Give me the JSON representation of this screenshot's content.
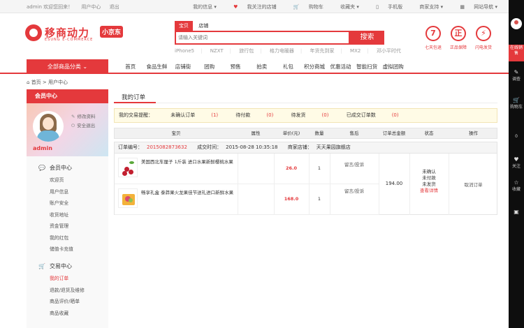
{
  "topbar": {
    "welcome": "admin 欢迎您回来！",
    "user_center": "用户中心",
    "logout": "退出",
    "my_info": "我的信息",
    "my_stores": "我关注的店铺",
    "cart": "购物车",
    "favorites": "收藏夹",
    "mobile": "手机版",
    "merchant": "商家支持",
    "sitenav": "网站导航"
  },
  "logo": {
    "name": "移商动力",
    "sub": "ESUNG E-COMMERCE",
    "tag": "小京东"
  },
  "search": {
    "tabs": [
      "宝贝",
      "店铺"
    ],
    "placeholder": "请输入关键词",
    "button": "搜索",
    "hot": [
      "iPhone5",
      "NZXT",
      "旅行包",
      "格力电暖器",
      "年货先到家",
      "MX2",
      "邓小平时代"
    ]
  },
  "badges": [
    {
      "icon": "7",
      "label": "七天包退"
    },
    {
      "icon": "正",
      "label": "正品保障"
    },
    {
      "icon": "⚡",
      "label": "闪电发货"
    }
  ],
  "nav": {
    "category_label": "全部商品分类",
    "items": [
      "首页",
      "食品生鲜",
      "店铺街",
      "团购",
      "预售",
      "拍卖",
      "礼包",
      "积分商城",
      "优惠活动",
      "智能扫货",
      "虚拟团购"
    ]
  },
  "breadcrumb": {
    "home": "首页",
    "sep": " > ",
    "current": "用户中心"
  },
  "sidebar": {
    "title": "会员中心",
    "username": "admin",
    "edit_profile": "修改资料",
    "safe_logout": "安全退出",
    "sections": [
      {
        "title": "会员中心",
        "items": [
          "欢迎页",
          "用户信息",
          "账户安全",
          "收货地址",
          "资金管理",
          "我的红包",
          "储值卡充值"
        ]
      },
      {
        "title": "交易中心",
        "items": [
          "我的订单",
          "退款/退货及维修",
          "商品评价/晒单",
          "商品收藏"
        ]
      }
    ],
    "active_item": "我的订单"
  },
  "main": {
    "title": "我的订单",
    "reminder": {
      "label": "我的交易提醒：",
      "unconfirmed": "未确认订单",
      "unconfirmed_count": "(1)",
      "unpaid": "待付款",
      "unpaid_count": "(0)",
      "unshipped": "待发货",
      "unshipped_count": "(0)",
      "done": "已成交订单数",
      "done_count": "(0)"
    },
    "table": {
      "headers": [
        "宝贝",
        "属性",
        "单价(元)",
        "数量",
        "售后",
        "订单总金额",
        "状态",
        "操作"
      ],
      "order_no_label": "订单编号：",
      "order_no": "2015082873632",
      "time_label": "成交时间：",
      "time": "2015-08-28 10:35:18",
      "store_label": "商家店铺：",
      "store": "天天果园旗舰店",
      "products": [
        {
          "name": "美国西北车厘子 1斤装 进口水果新鲜樱桃水果",
          "price": "26.0",
          "qty": "1",
          "aftersale": "留言/投诉"
        },
        {
          "name": "畅享礼盒 泰莽果火龙果佳节送礼进口新鲜水果",
          "price": "168.0",
          "qty": "1",
          "aftersale": "留言/投诉"
        }
      ],
      "total": "194.00",
      "status": [
        "未确认",
        "未付款",
        "未发货"
      ],
      "status_link": "查看详情",
      "operation": "取消订单"
    }
  },
  "rightbar": {
    "online": "在线销售",
    "items": [
      {
        "icon": "✎",
        "label": "调查"
      },
      {
        "icon": "🛒",
        "label": "购物车"
      },
      {
        "icon": "",
        "label": "0"
      },
      {
        "icon": "♥",
        "label": "关注"
      },
      {
        "icon": "☆",
        "label": "收藏"
      },
      {
        "icon": "▣",
        "label": ""
      }
    ]
  }
}
